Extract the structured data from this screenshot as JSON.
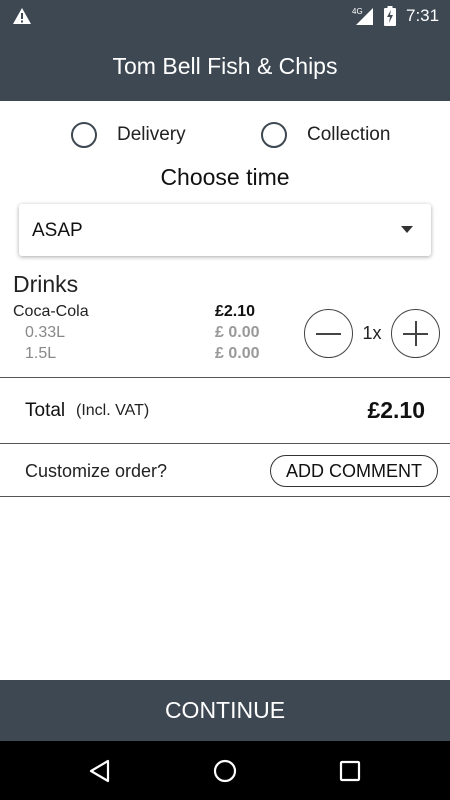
{
  "status_bar": {
    "time": "7:31",
    "network": "4G",
    "icons": [
      "warning-icon",
      "signal-icon",
      "battery-charging-icon"
    ]
  },
  "app_bar": {
    "title": "Tom Bell Fish & Chips"
  },
  "order_type": {
    "options": [
      {
        "label": "Delivery",
        "selected": false
      },
      {
        "label": "Collection",
        "selected": false
      }
    ]
  },
  "time_picker": {
    "heading": "Choose time",
    "selected": "ASAP"
  },
  "cart": {
    "section_title": "Drinks",
    "item": {
      "name": "Coca-Cola",
      "price": "£2.10",
      "quantity": "1x",
      "options": [
        {
          "name": "0.33L",
          "price": "£ 0.00"
        },
        {
          "name": "1.5L",
          "price": "£ 0.00"
        }
      ]
    }
  },
  "total": {
    "label": "Total",
    "sublabel": "(Incl. VAT)",
    "value": "£2.10"
  },
  "customize": {
    "question": "Customize order?",
    "button_label": "ADD COMMENT"
  },
  "footer": {
    "continue_label": "CONTINUE"
  },
  "colors": {
    "primary": "#3d4852",
    "nav_bar": "#000000",
    "background": "#ffffff"
  }
}
